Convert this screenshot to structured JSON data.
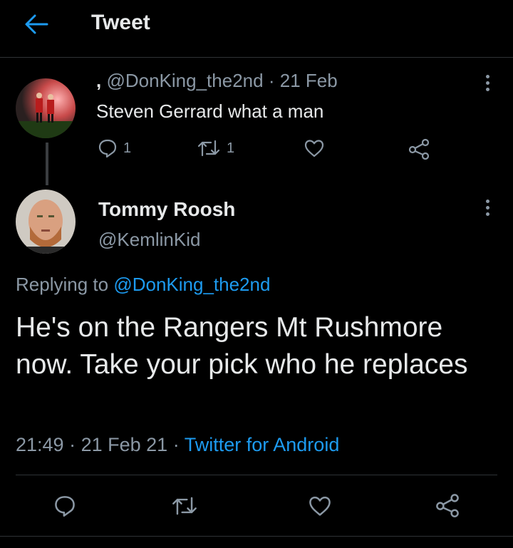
{
  "header": {
    "title": "Tweet",
    "back_icon": "arrow-left-icon",
    "accent": "#1d9bf0"
  },
  "parent_tweet": {
    "name": ",",
    "handle": "@DonKing_the2nd",
    "date": "21 Feb",
    "text": "Steven Gerrard what a man",
    "reply_count": "1",
    "retweet_count": "1"
  },
  "main_tweet": {
    "name": "Tommy Roosh",
    "handle": "@KemlinKid",
    "replying_prefix": "Replying to",
    "replying_handle": "@DonKing_the2nd",
    "text": "He's on the Rangers Mt Rushmore now. Take your pick who he replaces",
    "time": "21:49",
    "date": "21 Feb 21",
    "source": "Twitter for Android"
  }
}
